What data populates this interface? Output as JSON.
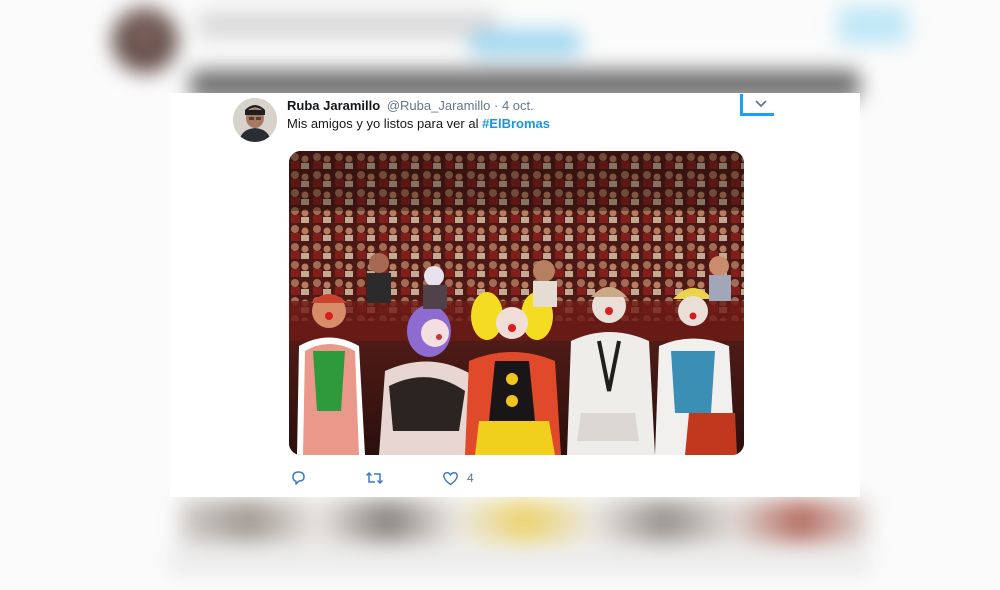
{
  "tweet": {
    "name": "Ruba Jaramillo",
    "handle": "@Ruba_Jaramillo",
    "separator": "·",
    "date": "4 oct.",
    "text": "Mis amigos y yo listos para ver al",
    "hashtag": "#ElBromas",
    "likes_count": "4"
  },
  "icons": {
    "avatar": "user-avatar",
    "menu": "chevron-down-icon",
    "reply": "reply-icon",
    "retweet": "retweet-icon",
    "like": "heart-icon"
  },
  "colors": {
    "link_blue": "#1b95e0",
    "accent_blue": "#1da1f2",
    "muted_gray": "#657786",
    "text_dark": "#14171a"
  }
}
